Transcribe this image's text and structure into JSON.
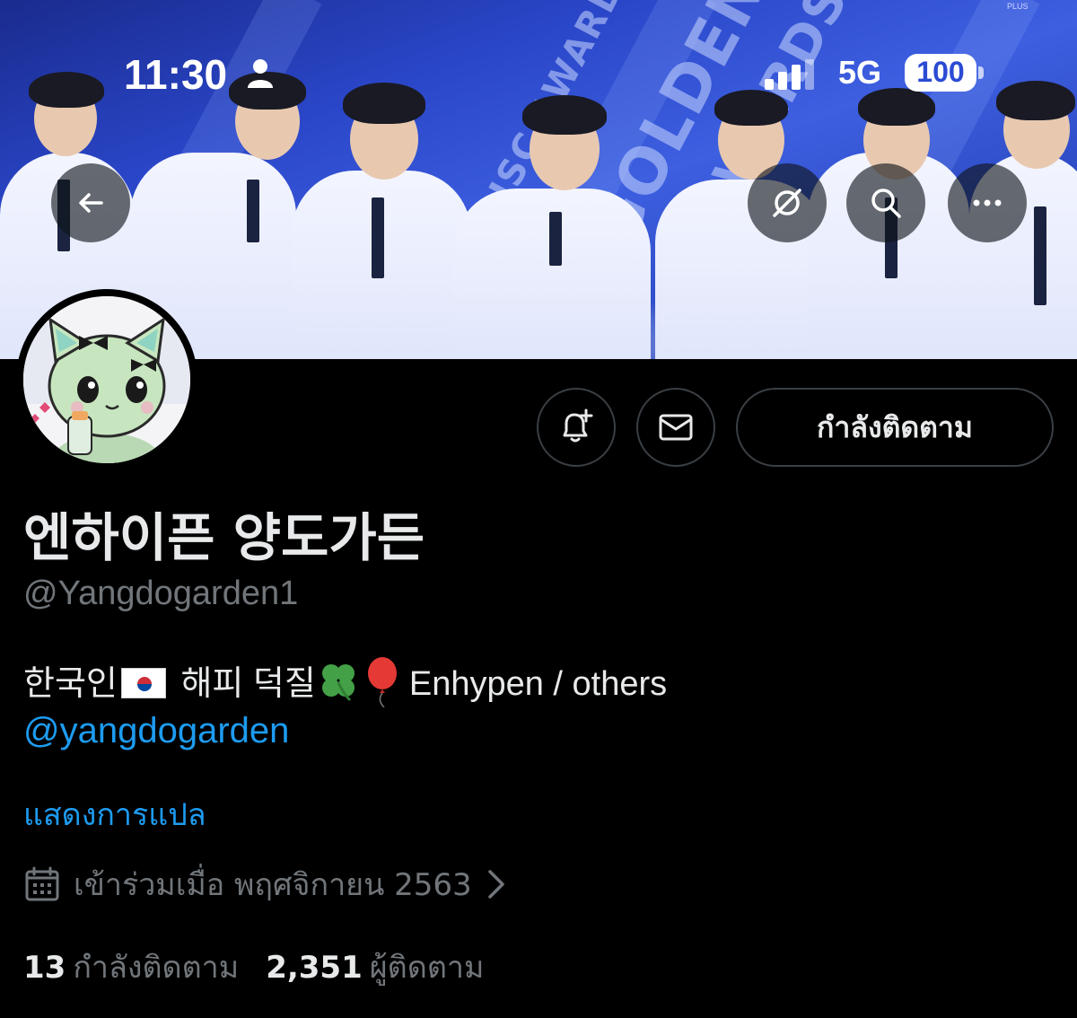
{
  "status_bar": {
    "time": "11:30",
    "network": "5G",
    "battery": "100",
    "corner_tag": "PLUS"
  },
  "header": {
    "icons": [
      "back-arrow-icon",
      "grok-icon",
      "search-icon",
      "more-icon"
    ]
  },
  "profile": {
    "display_name": "엔하이픈 양도가든",
    "handle": "@Yangdogarden1",
    "bio_part1": "한국인",
    "bio_part2": "해피 덕질",
    "bio_part3": "Enhypen / others",
    "bio_emoji": [
      "korea-flag",
      "four-leaf-clover",
      "red-balloon"
    ],
    "bio_mention": "@yangdogarden",
    "translate_label": "แสดงการแปล",
    "joined_text": "เข้าร่วมเมื่อ พฤศจิกายน 2563",
    "following_count": "13",
    "following_label": "กำลังติดตาม",
    "followers_count": "2,351",
    "followers_label": "ผู้ติดตาม"
  },
  "actions": {
    "follow_button": "กำลังติดตาม",
    "icons": [
      "bell-plus-icon",
      "message-icon"
    ]
  },
  "colors": {
    "background": "#000000",
    "link": "#1d9bf0",
    "secondary_text": "#71767b",
    "primary_text": "#e7e9ea"
  }
}
